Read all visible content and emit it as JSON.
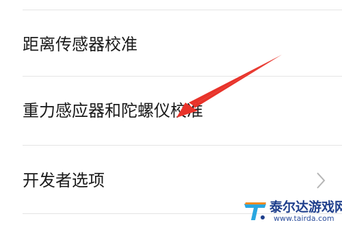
{
  "settings": {
    "items": [
      {
        "label": "距离传感器校准",
        "has_chevron": false
      },
      {
        "label": "重力感应器和陀螺仪校准",
        "has_chevron": false
      },
      {
        "label": "开发者选项",
        "has_chevron": true
      }
    ]
  },
  "annotation": {
    "color": "#e8332a",
    "icon": "red-arrow-pointer"
  },
  "watermark": {
    "brand": "泰尔达游戏网",
    "url": "www.tairda.com",
    "colors": {
      "primary": "#1f3f8c",
      "accent": "#2aa7e0",
      "orange": "#f08a1c"
    }
  }
}
